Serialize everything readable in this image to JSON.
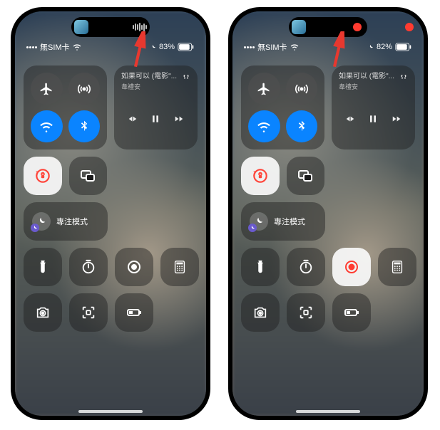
{
  "phones": [
    {
      "variant": "left",
      "island_right": "waveform",
      "status": {
        "carrier": "無SIM卡",
        "battery": "83%"
      },
      "recording_active": false,
      "media": {
        "title": "如果可以 (電影\"...",
        "artist": "韋禮安"
      },
      "focus_label": "專注模式"
    },
    {
      "variant": "right",
      "island_right": "dot",
      "status": {
        "carrier": "無SIM卡",
        "battery": "82%"
      },
      "recording_active": true,
      "media": {
        "title": "如果可以 (電影\"...",
        "artist": "韋禮安"
      },
      "focus_label": "專注模式"
    }
  ],
  "icons": {
    "airplane": "airplane-icon",
    "cellular": "cellular-icon",
    "wifi": "wifi-icon",
    "bluetooth": "bluetooth-icon",
    "orientation_lock": "orientation-lock-icon",
    "screen_mirror": "screen-mirror-icon",
    "brightness": "brightness-icon",
    "volume": "airpods-icon",
    "flashlight": "flashlight-icon",
    "timer": "timer-icon",
    "screen_record": "screen-record-icon",
    "calculator": "calculator-icon",
    "camera": "camera-icon",
    "qr": "qr-icon",
    "low_power": "low-power-icon",
    "prev": "prev-icon",
    "pause": "pause-icon",
    "next": "next-icon",
    "airplay": "airplay-icon",
    "focus": "focus-icon"
  },
  "colors": {
    "accent": "#0a84ff",
    "record": "#ff3b30"
  }
}
